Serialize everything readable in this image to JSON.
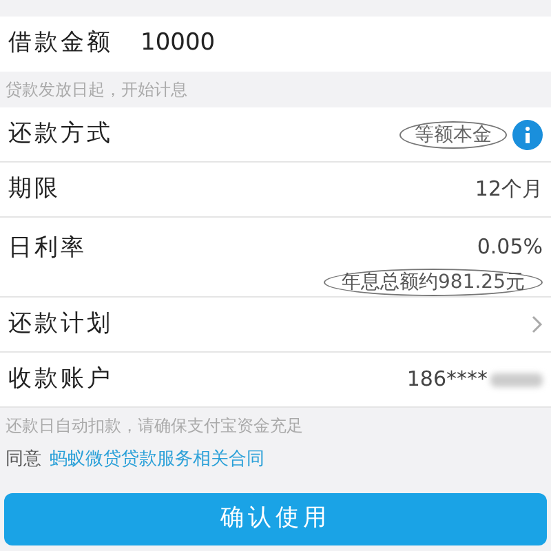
{
  "amount": {
    "label": "借款金额",
    "value": "10000"
  },
  "amount_note": "贷款发放日起，开始计息",
  "rows": [
    {
      "kind": "method",
      "label": "还款方式",
      "value": "等额本金"
    },
    {
      "kind": "plain",
      "label": "期限",
      "value": "12个月"
    },
    {
      "kind": "rate",
      "label": "日利率",
      "value": "0.05%",
      "sub": "年息总额约981.25元"
    },
    {
      "kind": "link",
      "label": "还款计划"
    },
    {
      "kind": "account",
      "label": "收款账户",
      "value": "186****"
    }
  ],
  "debit_note": "还款日自动扣款，请确保支付宝资金充足",
  "agreement": {
    "prefix": "同意",
    "link": "蚂蚁微贷贷款服务相关合同"
  },
  "confirm_button": "确认使用"
}
